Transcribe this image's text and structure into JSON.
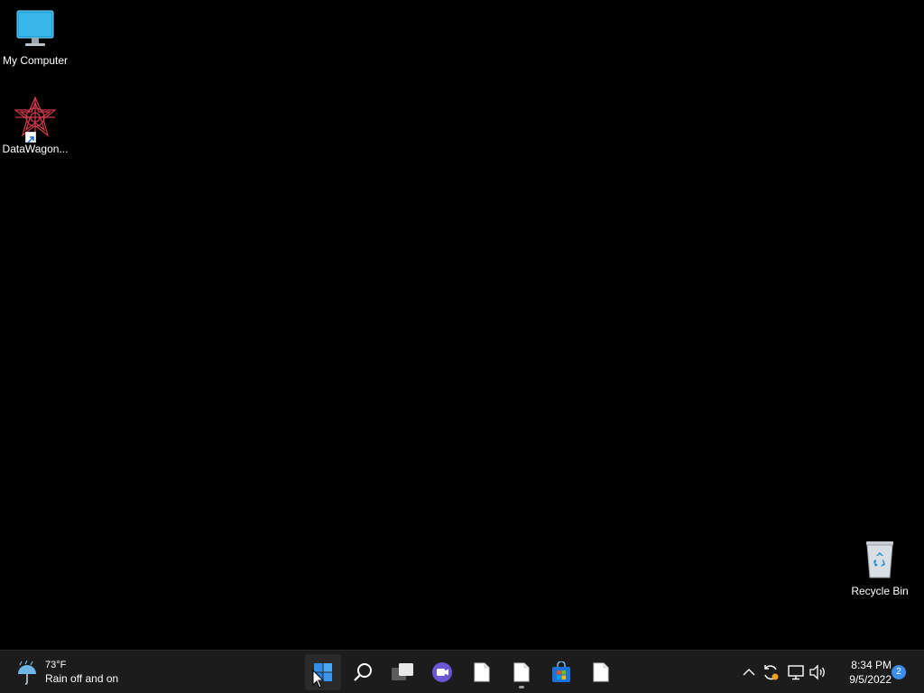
{
  "desktop": {
    "icons": [
      {
        "label": "My Computer",
        "icon": "monitor-icon"
      },
      {
        "label": "DataWagon...",
        "icon": "datawagon-logo-icon"
      },
      {
        "label": "Recycle Bin",
        "icon": "recycle-bin-icon"
      }
    ]
  },
  "taskbar": {
    "weather": {
      "temp": "73°F",
      "condition": "Rain off and on",
      "icon": "rain-umbrella-icon"
    },
    "apps": [
      {
        "name": "Start",
        "icon": "windows-start-icon"
      },
      {
        "name": "Search",
        "icon": "search-icon"
      },
      {
        "name": "Task View",
        "icon": "task-view-icon"
      },
      {
        "name": "Chat",
        "icon": "chat-camera-icon"
      },
      {
        "name": "File",
        "icon": "file-icon"
      },
      {
        "name": "File",
        "icon": "file-icon"
      },
      {
        "name": "Microsoft Store",
        "icon": "store-icon"
      },
      {
        "name": "File",
        "icon": "file-icon"
      }
    ],
    "tray": {
      "icons": [
        "chevron-up-icon",
        "sync-icon",
        "network-icon",
        "volume-icon"
      ],
      "time": "8:34 PM",
      "date": "9/5/2022",
      "notification_count": "2"
    }
  },
  "colors": {
    "desktop_bg": "#000000",
    "taskbar_bg": "#1c1c1c",
    "accent": "#3b8eea"
  }
}
